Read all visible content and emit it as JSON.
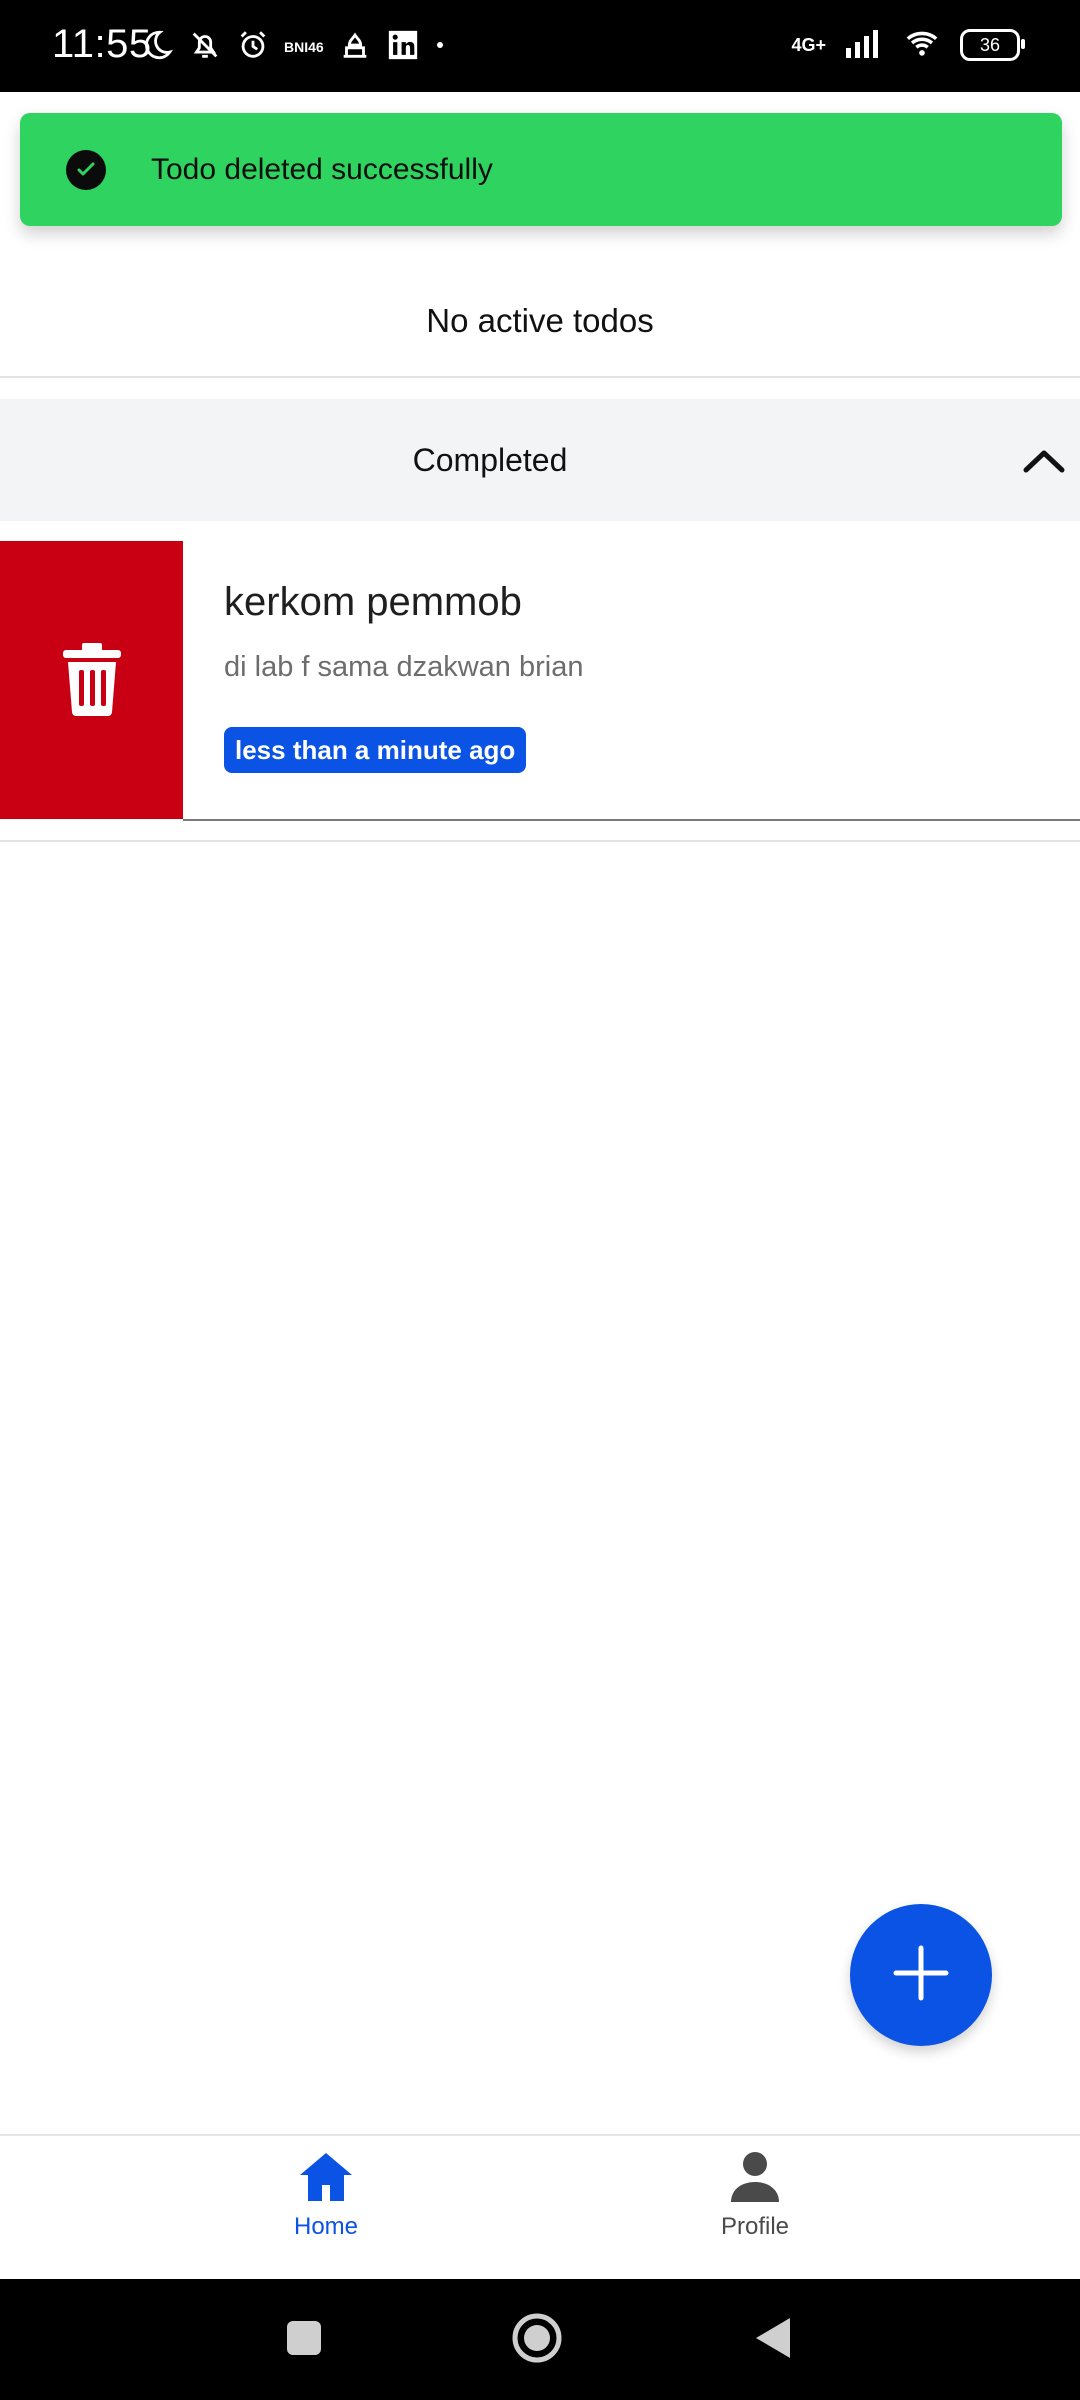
{
  "status_bar": {
    "time": "11:55",
    "small_label": "BNI46",
    "network": "4G+",
    "battery": "36"
  },
  "toast": {
    "message": "Todo deleted successfully"
  },
  "active_section": {
    "empty_text": "No active todos"
  },
  "completed_section": {
    "title": "Completed",
    "items": [
      {
        "title": "kerkom pemmob",
        "description": "di lab f sama dzakwan brian",
        "time_badge": "less than a minute ago"
      }
    ]
  },
  "bottom_nav": {
    "items": [
      {
        "label": "Home",
        "icon": "home-icon",
        "active": true
      },
      {
        "label": "Profile",
        "icon": "person-icon",
        "active": false
      }
    ]
  },
  "colors": {
    "primary": "#0a53e4",
    "toast_bg": "#2fd35f",
    "delete_bg": "#c90014",
    "section_bg": "#f3f4f6"
  }
}
